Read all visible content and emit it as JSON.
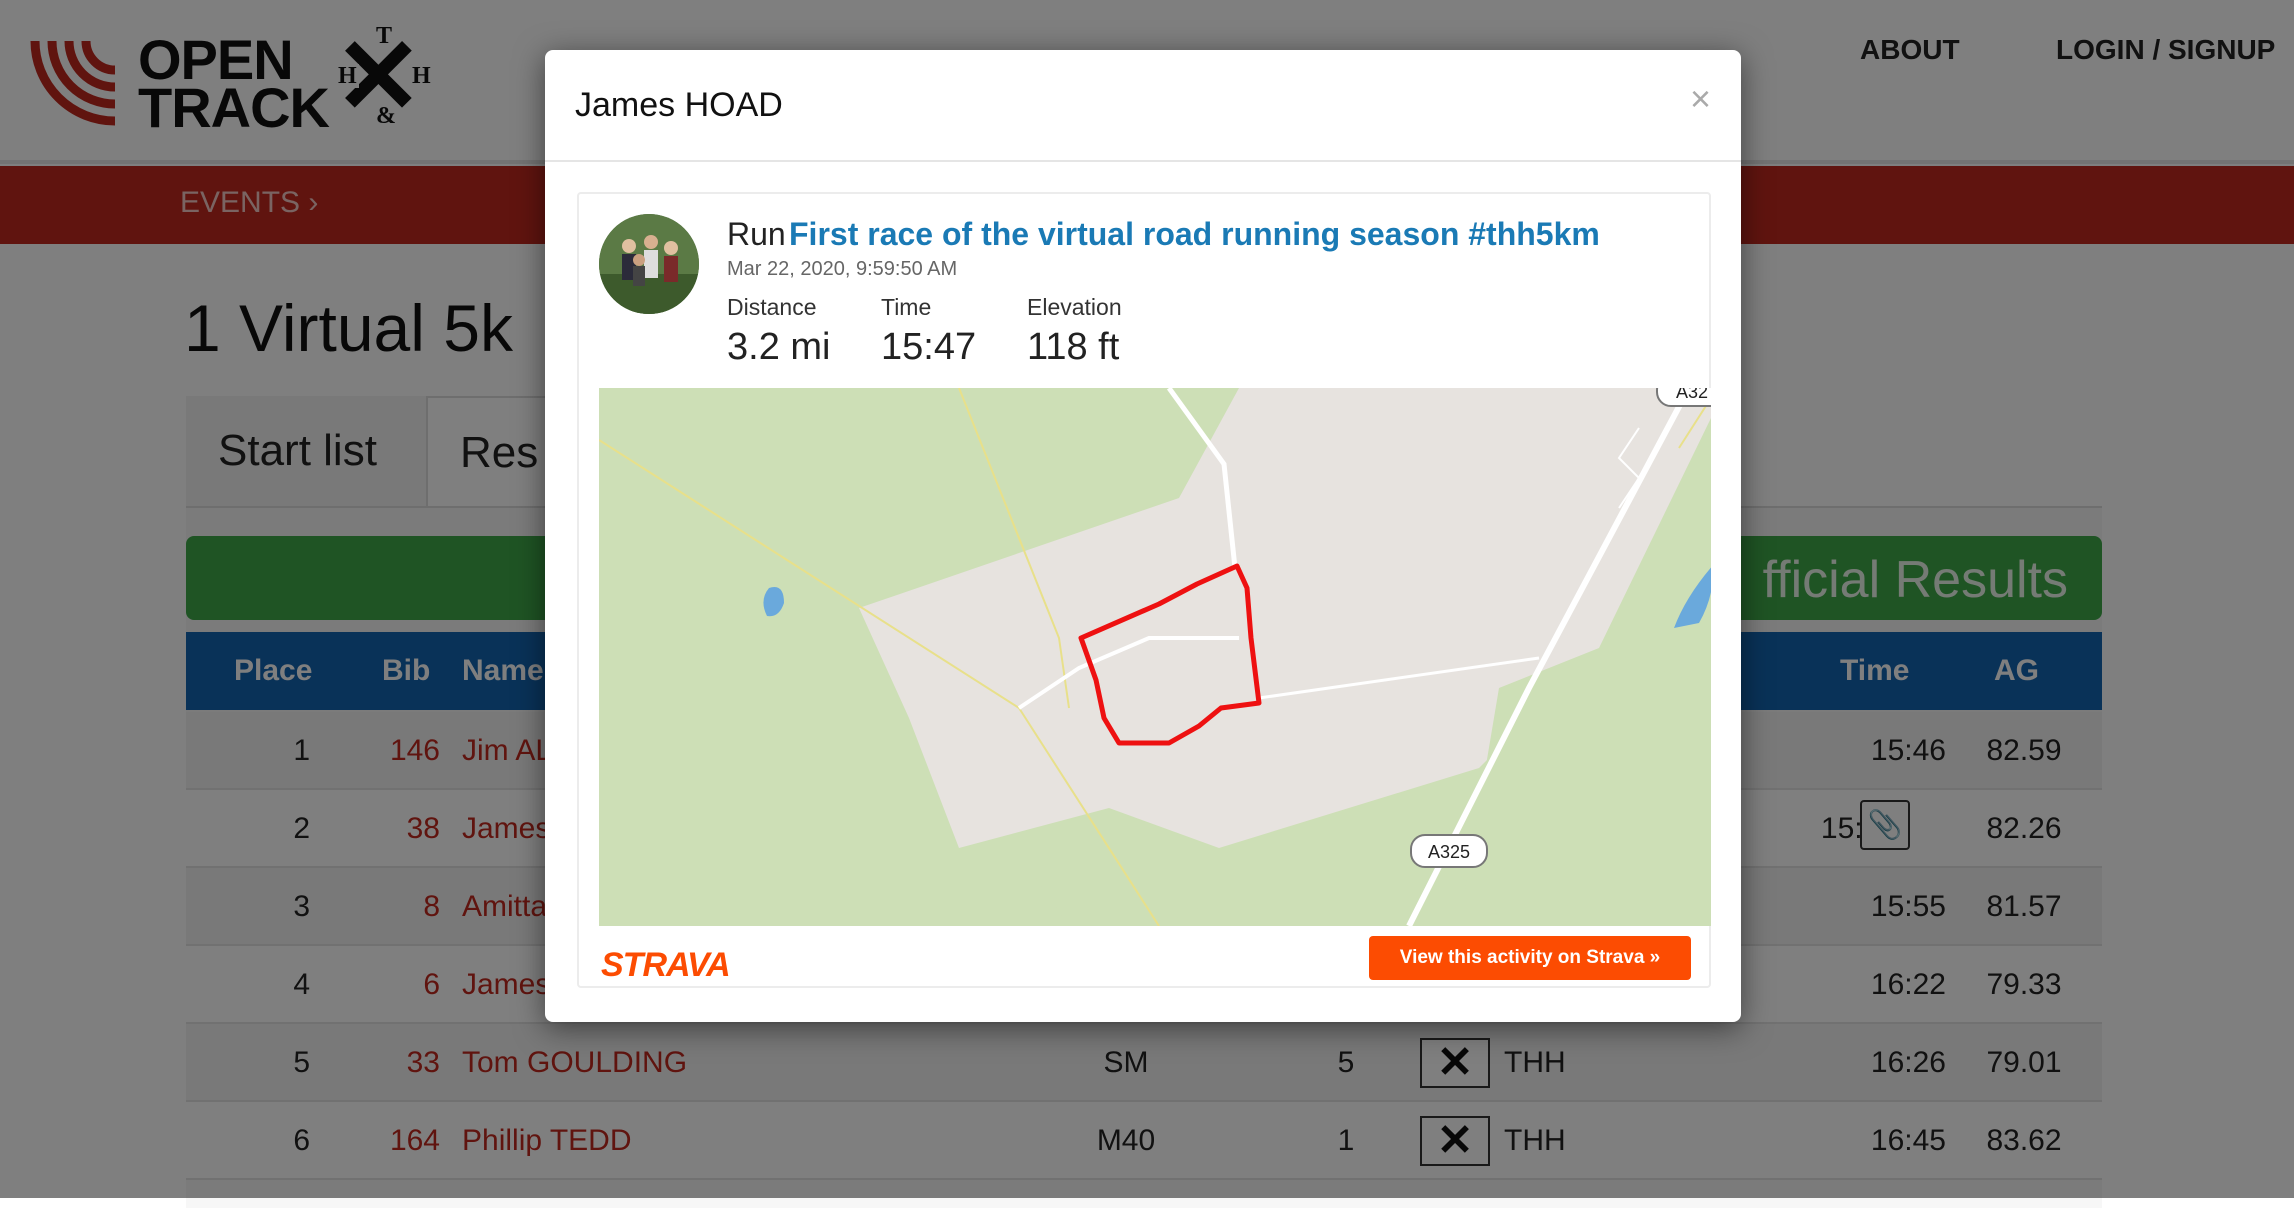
{
  "header": {
    "brand_line1": "OPEN",
    "brand_line2": "TRACK",
    "club_logo_letters": [
      "T",
      "H",
      "H",
      "&"
    ],
    "nav": [
      "ABOUT",
      "LOGIN / SIGNUP"
    ]
  },
  "subnav": {
    "events_label": "EVENTS"
  },
  "page": {
    "title": "1 Virtual 5k",
    "tabs": [
      "Start list",
      "Res"
    ],
    "results_banner": "fficial Results"
  },
  "table": {
    "headers": {
      "place": "Place",
      "bib": "Bib",
      "name": "Name",
      "time": "Time",
      "ag": "AG"
    },
    "rows": [
      {
        "place": "1",
        "bib": "146",
        "name": "Jim AL",
        "cat": "",
        "pos": "",
        "team": "",
        "time": "15:46",
        "ag": "82.59"
      },
      {
        "place": "2",
        "bib": "38",
        "name": "James",
        "cat": "",
        "pos": "",
        "team": "",
        "time": "15:47",
        "ag": "82.26"
      },
      {
        "place": "3",
        "bib": "8",
        "name": "Amitta",
        "cat": "",
        "pos": "",
        "team": "",
        "time": "15:55",
        "ag": "81.57"
      },
      {
        "place": "4",
        "bib": "6",
        "name": "James",
        "cat": "",
        "pos": "",
        "team": "",
        "time": "16:22",
        "ag": "79.33"
      },
      {
        "place": "5",
        "bib": "33",
        "name": "Tom GOULDING",
        "cat": "SM",
        "pos": "5",
        "team": "THH",
        "time": "16:26",
        "ag": "79.01"
      },
      {
        "place": "6",
        "bib": "164",
        "name": "Phillip TEDD",
        "cat": "M40",
        "pos": "1",
        "team": "THH",
        "time": "16:45",
        "ag": "83.62"
      }
    ]
  },
  "modal": {
    "title": "James HOAD",
    "close_label": "×",
    "activity": {
      "type": "Run",
      "title": "First race of the virtual road running season #thh5km",
      "date": "Mar 22, 2020, 9:59:50 AM",
      "stats": [
        {
          "label": "Distance",
          "value": "3.2 mi"
        },
        {
          "label": "Time",
          "value": "15:47"
        },
        {
          "label": "Elevation",
          "value": "118 ft"
        }
      ],
      "map_road_labels": [
        "A325",
        "A32"
      ]
    },
    "strava_logo": "STRAVA",
    "strava_button": "View this activity on Strava »"
  },
  "colors": {
    "brand_red": "#c1291f",
    "table_header_blue": "#1265b1",
    "results_green": "#3ea848",
    "strava_orange": "#fc4c02",
    "link_blue": "#1a7ab5",
    "route_red": "#ee1111"
  }
}
